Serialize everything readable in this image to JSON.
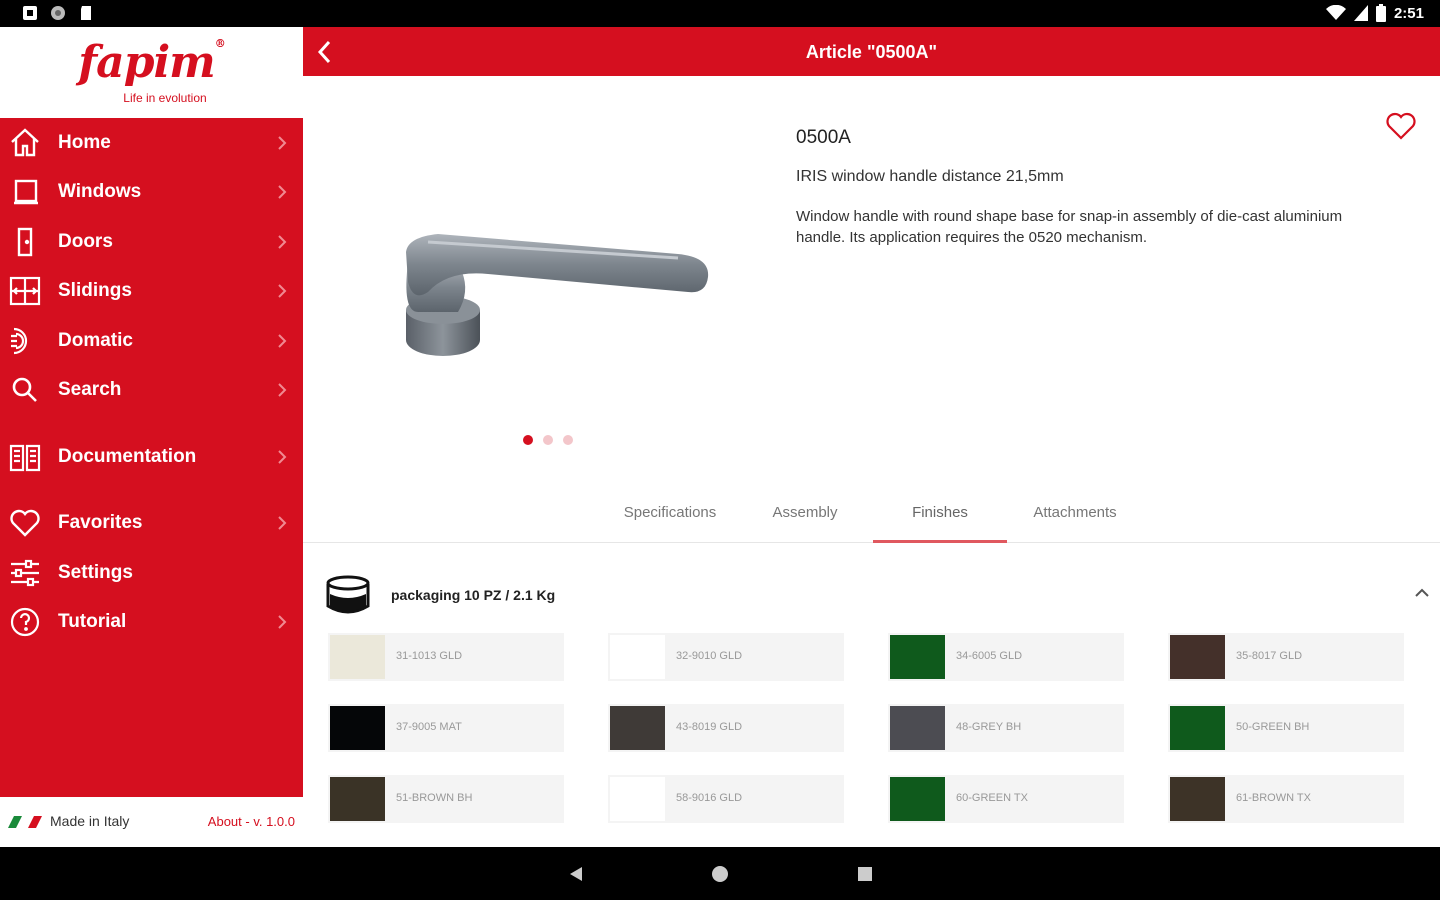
{
  "status_bar": {
    "time": "2:51",
    "icons": [
      "notification-icon",
      "circle-icon",
      "sd-card-icon",
      "wifi-icon",
      "signal-icon",
      "battery-icon"
    ]
  },
  "sidebar": {
    "brand": "fapim",
    "brand_mark": "®",
    "tagline": "Life in evolution",
    "items": [
      {
        "label": "Home",
        "icon": "home-icon"
      },
      {
        "label": "Windows",
        "icon": "window-icon"
      },
      {
        "label": "Doors",
        "icon": "door-icon"
      },
      {
        "label": "Slidings",
        "icon": "sliding-icon"
      },
      {
        "label": "Domatic",
        "icon": "domatic-icon"
      },
      {
        "label": "Search",
        "icon": "search-icon"
      },
      {
        "label": "Documentation",
        "icon": "book-icon"
      },
      {
        "label": "Favorites",
        "icon": "heart-icon"
      },
      {
        "label": "Settings",
        "icon": "sliders-icon"
      },
      {
        "label": "Tutorial",
        "icon": "help-icon"
      }
    ],
    "footer": {
      "made_in": "Made in Italy",
      "about": "About - v. 1.0.0"
    }
  },
  "header": {
    "title": "Article \"0500A\""
  },
  "product": {
    "code": "0500A",
    "name": "IRIS window handle distance 21,5mm",
    "description": "Window handle with round shape base for snap-in assembly of die-cast aluminium handle. Its application requires the 0520 mechanism.",
    "carousel_pages": 3,
    "carousel_active": 0
  },
  "tabs": [
    {
      "label": "Specifications"
    },
    {
      "label": "Assembly"
    },
    {
      "label": "Finishes"
    },
    {
      "label": "Attachments"
    }
  ],
  "active_tab": "Finishes",
  "packaging": {
    "label": "packaging 10 PZ / 2.1 Kg"
  },
  "finishes": [
    {
      "label": "31-1013 GLD",
      "color": "#ebe8da"
    },
    {
      "label": "32-9010 GLD",
      "color": "#ffffff"
    },
    {
      "label": "34-6005 GLD",
      "color": "#0f5a1c"
    },
    {
      "label": "35-8017 GLD",
      "color": "#44302a"
    },
    {
      "label": "37-9005 MAT",
      "color": "#050608"
    },
    {
      "label": "43-8019 GLD",
      "color": "#3f3a37"
    },
    {
      "label": "48-GREY BH",
      "color": "#4c4c52"
    },
    {
      "label": "50-GREEN BH",
      "color": "#0f5a1c"
    },
    {
      "label": "51-BROWN BH",
      "color": "#3a3326"
    },
    {
      "label": "58-9016 GLD",
      "color": "#ffffff"
    },
    {
      "label": "60-GREEN TX",
      "color": "#0f5a1c"
    },
    {
      "label": "61-BROWN TX",
      "color": "#3d3327"
    }
  ],
  "colors": {
    "brand_red": "#d50f1f",
    "tab_indicator": "#e0585f"
  }
}
